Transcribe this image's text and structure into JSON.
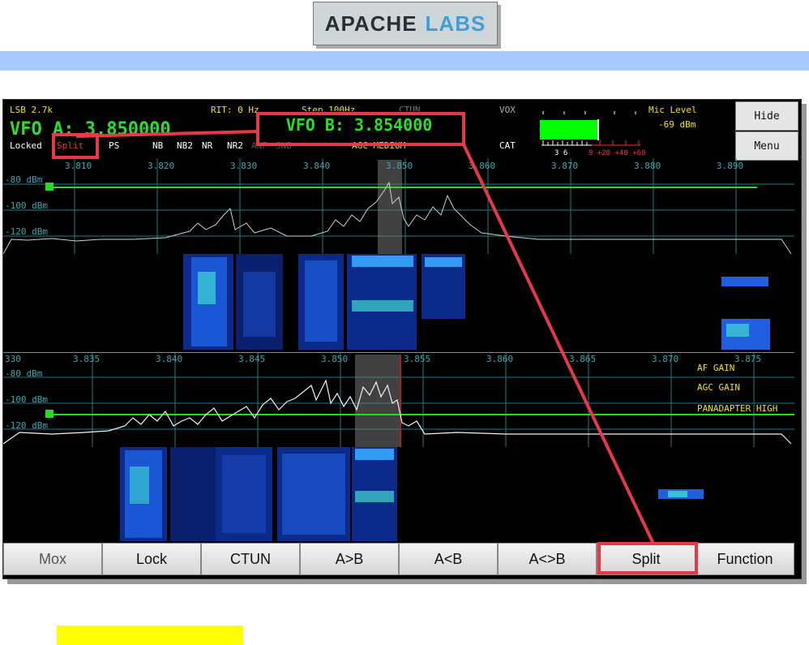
{
  "logo": {
    "part1": "APACHE",
    "part2": "LABS"
  },
  "status": {
    "mode": "LSB 2.7k",
    "rit": "RIT: 0 Hz",
    "step": "Step 100Hz",
    "ctun": "CTUN",
    "vox": "VOX",
    "vfo_a": "VFO A: 3.850000",
    "vfo_b": "VFO B: 3.854000",
    "locked": "Locked",
    "split": "Split",
    "ps": "PS",
    "nb": "NB",
    "nb2": "NB2",
    "nr": "NR",
    "nr2": "NR2",
    "anf": "ANF",
    "snb": "SNB",
    "agc": "AGC MEDIUM",
    "cat": "CAT",
    "mic_level_label": "Mic Level",
    "mic_level_value": "-69 dBm",
    "meter_scale_white": "3 6",
    "meter_scale_red": "9 +20 +40 +60"
  },
  "side_buttons": {
    "hide": "Hide",
    "menu": "Menu"
  },
  "panadapter_top": {
    "freq_labels": [
      "3.810",
      "3.820",
      "3.830",
      "3.840",
      "3.850",
      "3.860",
      "3.870",
      "3.880",
      "3.890"
    ],
    "db_labels": [
      "-80 dBm",
      "-100 dBm",
      "-120 dBm"
    ]
  },
  "panadapter_bottom": {
    "freq_labels": [
      "330",
      "3.835",
      "3.840",
      "3.845",
      "3.850",
      "3.855",
      "3.860",
      "3.865",
      "3.870",
      "3.875"
    ],
    "db_labels": [
      "-80 dBm",
      "-100 dBm",
      "-120 dBm"
    ],
    "overlay": [
      "AF GAIN",
      "AGC GAIN",
      "PANADAPTER HIGH"
    ]
  },
  "bottom_buttons": [
    "Mox",
    "Lock",
    "CTUN",
    "A>B",
    "A<B",
    "A<>B",
    "Split",
    "Function"
  ],
  "colors": {
    "highlight": "#e53a46",
    "signal": "#28e028",
    "scale": "#36a9b4",
    "agc": "#f2e400"
  }
}
